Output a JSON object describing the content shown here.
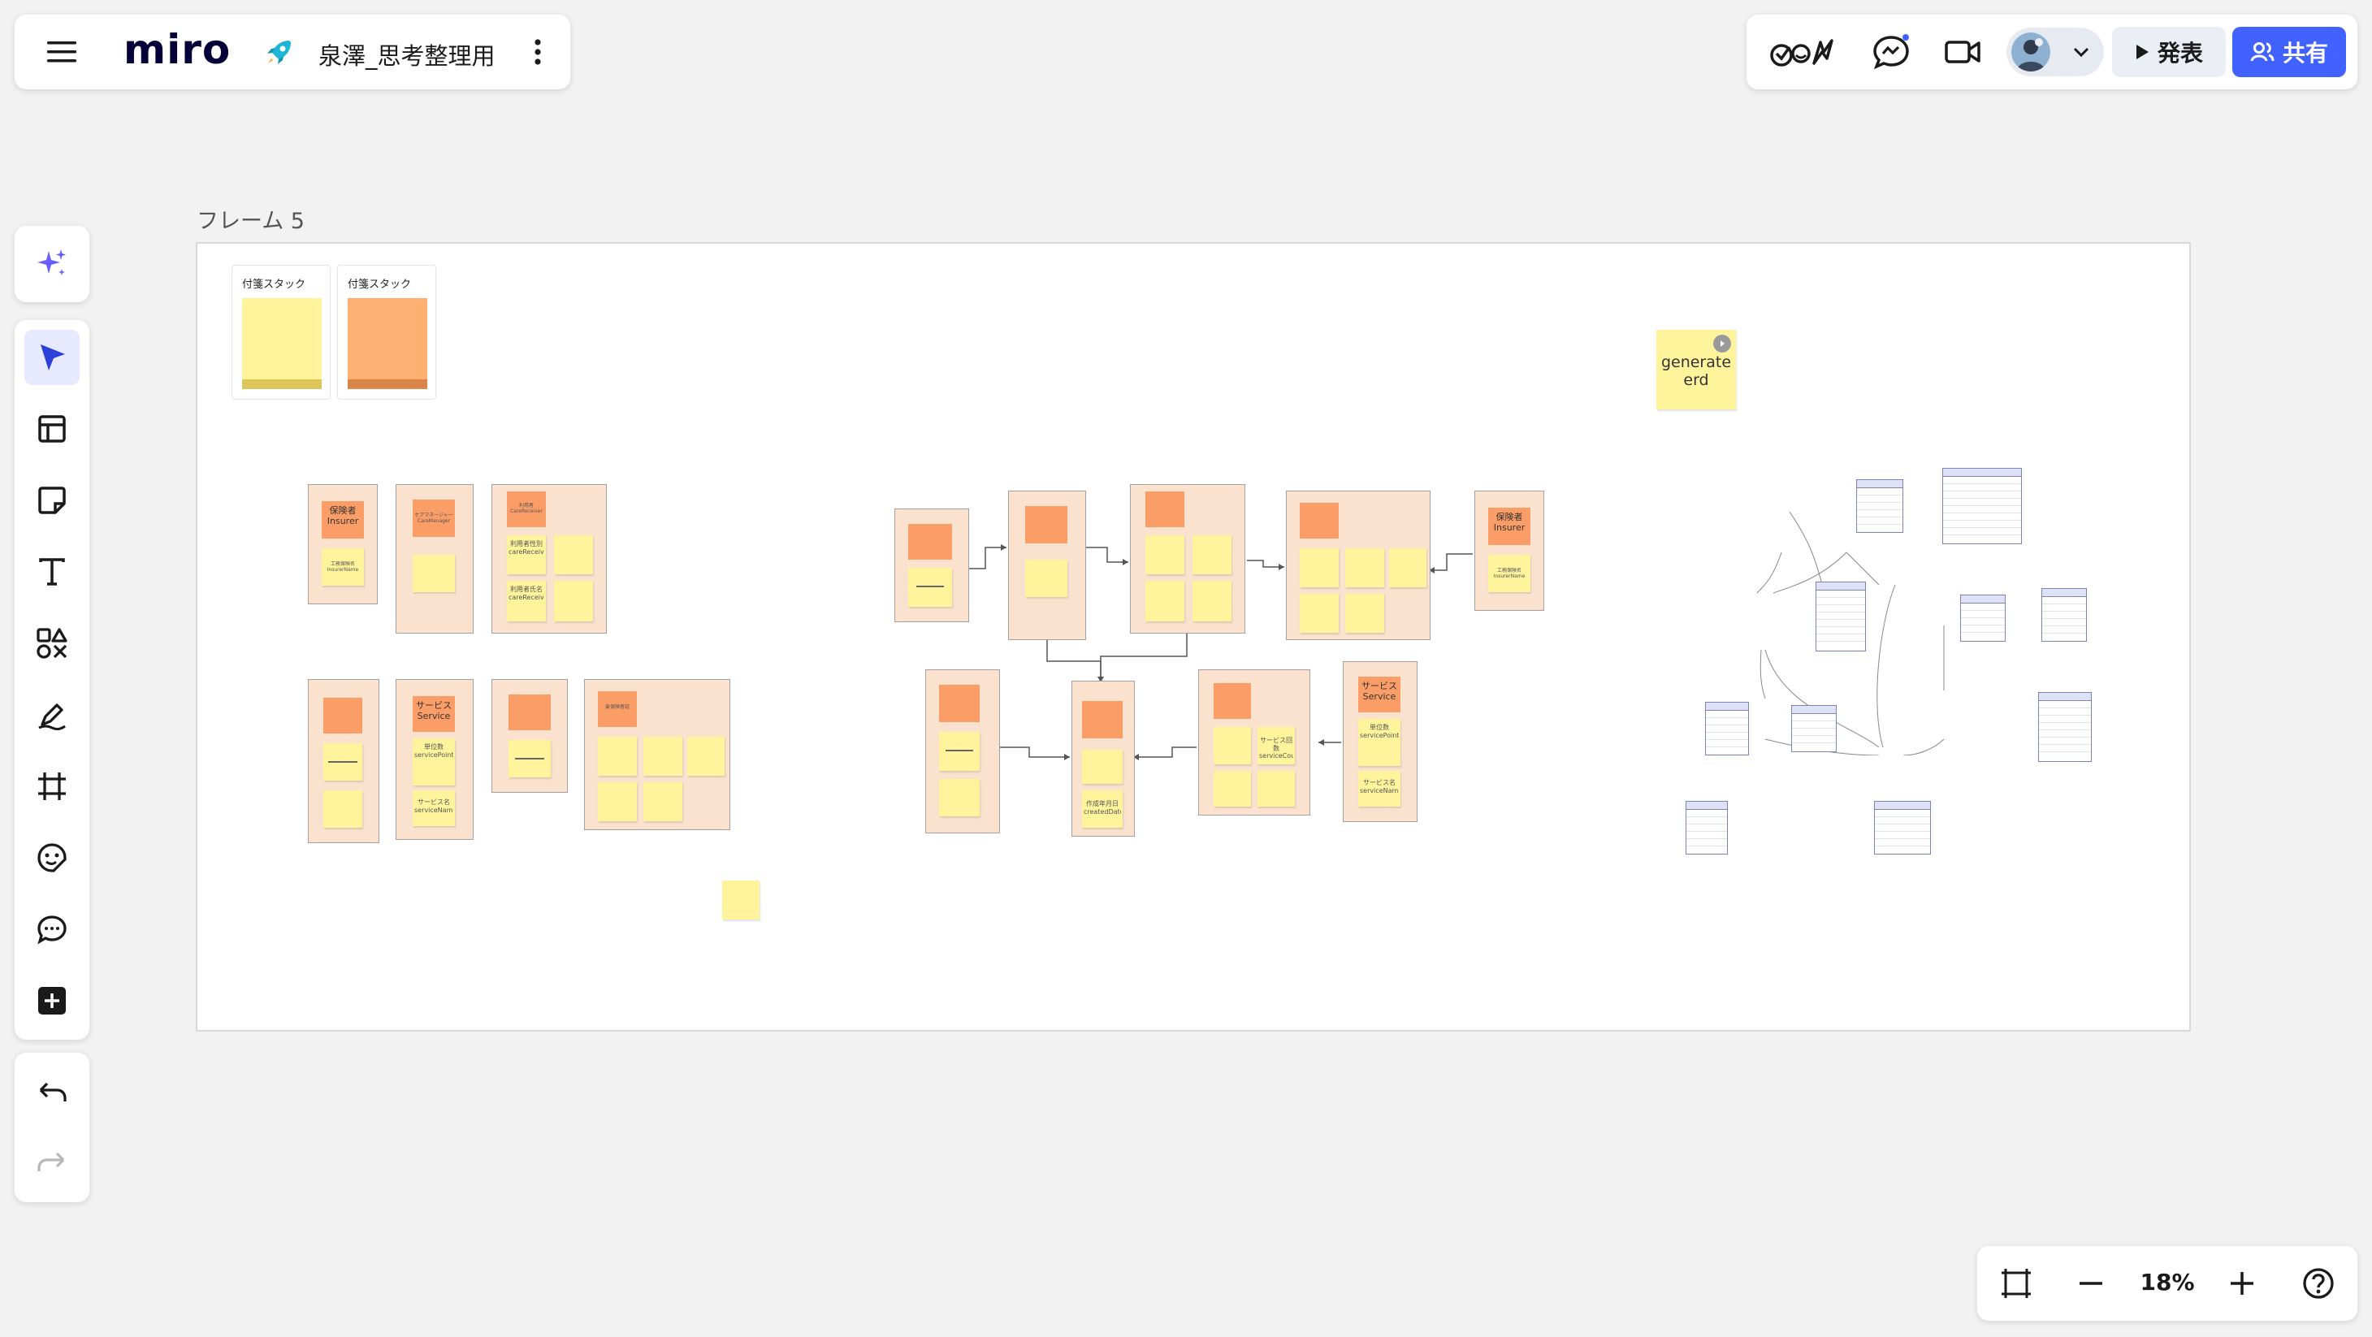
{
  "app": {
    "logo": "miro",
    "board_name": "泉澤_思考整理用"
  },
  "toolbar_right": {
    "present_label": "発表",
    "share_label": "共有"
  },
  "zoom": {
    "level": "18%"
  },
  "frame": {
    "title": "フレーム 5",
    "stacks": [
      {
        "label": "付箋スタック"
      },
      {
        "label": "付箋スタック"
      }
    ],
    "generate_note": "generate erd"
  },
  "colors": {
    "accent": "#4262ff",
    "entity_bg": "#fbe2cf",
    "entity_header": "#fb9d66",
    "sticky_yellow": "#fff49b",
    "erd_border": "#7d82b8"
  },
  "entities": {
    "insurer1": {
      "header": "保険者 Insurer",
      "field": "工務保険名 InsurerName"
    },
    "cm1": {
      "header": "ケアマネージャー CareManager"
    },
    "cr1": {
      "header": "利用者 CareReceiver",
      "f1": "利用者性別 careReceiverGender",
      "f2": "利用者氏名 careReceiverFullName"
    },
    "service1": {
      "header": "サービス Service",
      "f1": "単位数 servicePointIncludingDiscount",
      "f2": "サービス名 serviceName"
    },
    "cert1": {
      "header": "要保険者証"
    },
    "insurer2": {
      "header": "保険者 Insurer",
      "field": "工務保険名 InsurerName"
    },
    "plan2": {
      "f1": "作成年月日 createdDate"
    },
    "svc2": {
      "header": "サービス Service",
      "f1": "単位数 servicePointIncludingDiscount",
      "f2": "サービス名 serviceName"
    },
    "svc_alloc": {
      "f1": "サービス回数 serviceCount"
    }
  }
}
